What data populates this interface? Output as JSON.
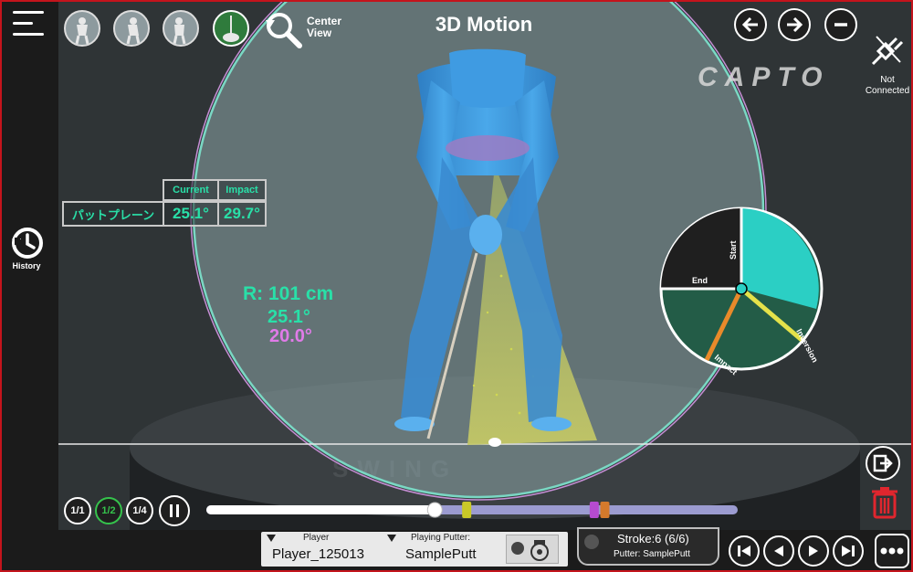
{
  "header": {
    "title": "3D Motion",
    "center_view_line1": "Center",
    "center_view_line2": "View",
    "brand": "CAPTO",
    "connection_line1": "Not",
    "connection_line2": "Connected"
  },
  "sidebar": {
    "history_label": "History"
  },
  "angle_table": {
    "col_current": "Current",
    "col_impact": "Impact",
    "row_label": "パットプレーン",
    "current_value": "25.1°",
    "impact_value": "29.7°"
  },
  "overlay": {
    "radius": "R: 101 cm",
    "angle_green": "25.1°",
    "angle_pink": "20.0°"
  },
  "pie": {
    "label_start": "Start",
    "label_end": "End",
    "label_impact": "Impact",
    "label_inversion": "Inversion"
  },
  "playback": {
    "speeds": [
      "1/1",
      "1/2",
      "1/4"
    ],
    "active_speed": "1/2",
    "progress": 0.43,
    "markers": [
      {
        "name": "marker-1",
        "position": 0.49,
        "color": "#c9c928"
      },
      {
        "name": "marker-2",
        "position": 0.73,
        "color": "#b64bd0"
      },
      {
        "name": "marker-3",
        "position": 0.75,
        "color": "#d57a2c"
      }
    ]
  },
  "player_panel": {
    "player_caption": "Player",
    "player_value": "Player_125013",
    "putter_caption": "Playing Putter:",
    "putter_value": "SamplePutt"
  },
  "stroke_panel": {
    "stroke": "Stroke:6 (6/6)",
    "putter": "Putter: SamplePutt"
  },
  "colors": {
    "accent_green": "#29e0a8",
    "accent_pink": "#e07be8",
    "frame_red": "#c4141c",
    "delete_red": "#e0262e"
  },
  "icons": [
    "menu-icon",
    "camera-rotate-icon",
    "history-icon",
    "zoom-reset-icon",
    "arrow-left-icon",
    "arrow-right-icon",
    "minus-icon",
    "plug-disconnected-icon",
    "exit-icon",
    "trash-icon",
    "pause-icon",
    "skip-start-icon",
    "step-back-icon",
    "play-icon",
    "skip-end-icon",
    "more-icon",
    "camera-settings-icon"
  ]
}
